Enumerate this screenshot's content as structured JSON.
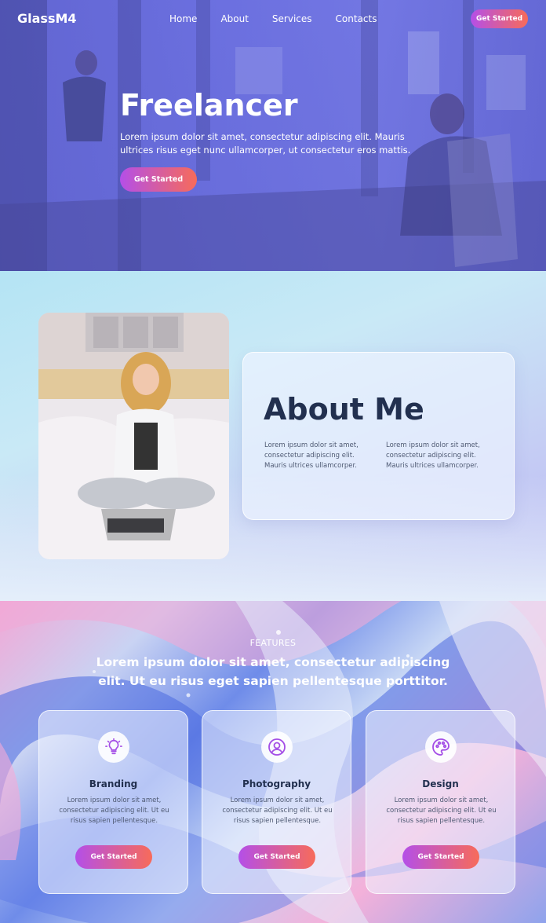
{
  "brand": {
    "logo": "GlassM4"
  },
  "nav": {
    "items": [
      "Home",
      "About",
      "Services",
      "Contacts"
    ],
    "cta": "Get Started"
  },
  "hero": {
    "title": "Freelancer",
    "subtitle": "Lorem ipsum dolor sit amet, consectetur adipiscing elit. Mauris ultrices risus eget nunc ullamcorper, ut consectetur eros mattis.",
    "cta": "Get Started"
  },
  "about": {
    "title": "About Me",
    "col1": "Lorem ipsum dolor sit amet, consectetur adipiscing elit. Mauris ultrices ullamcorper.",
    "col2": "Lorem ipsum dolor sit amet, consectetur adipiscing elit. Mauris ultrices ullamcorper."
  },
  "features": {
    "label": "FEATURES",
    "heading": "Lorem ipsum dolor sit amet, consectetur adipiscing elit. Ut eu risus eget sapien pellentesque porttitor.",
    "cards": [
      {
        "icon": "lightbulb-icon",
        "title": "Branding",
        "text": "Lorem ipsum dolor sit amet, consectetur adipiscing elit. Ut eu risus sapien pellentesque.",
        "cta": "Get Started"
      },
      {
        "icon": "user-icon",
        "title": "Photography",
        "text": "Lorem ipsum dolor sit amet, consectetur adipiscing elit. Ut eu risus sapien pellentesque.",
        "cta": "Get Started"
      },
      {
        "icon": "palette-icon",
        "title": "Design",
        "text": "Lorem ipsum dolor sit amet, consectetur adipiscing elit. Ut eu risus sapien pellentesque.",
        "cta": "Get Started"
      }
    ]
  },
  "colors": {
    "accent_start": "#b44fe8",
    "accent_end": "#f76b5a",
    "hero_overlay": "#6c70e6",
    "heading": "#22304f"
  }
}
